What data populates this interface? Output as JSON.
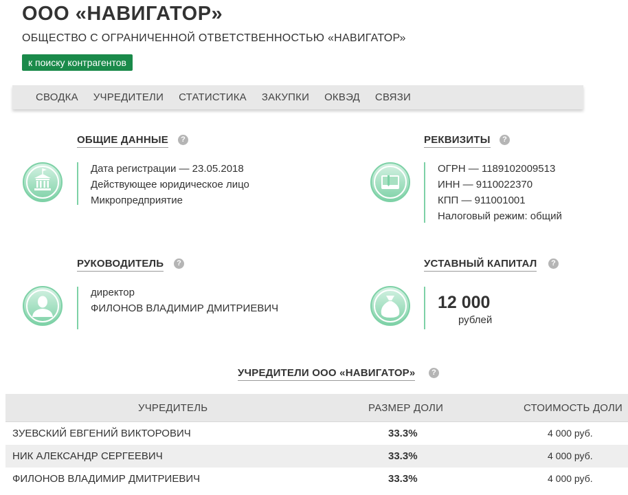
{
  "header": {
    "title": "ООО «НАВИГАТОР»",
    "full_name": "ОБЩЕСТВО С ОГРАНИЧЕННОЙ ОТВЕТСТВЕННОСТЬЮ «НАВИГАТОР»",
    "back_button": "к поиску контрагентов"
  },
  "nav": [
    "СВОДКА",
    "УЧРЕДИТЕЛИ",
    "СТАТИСТИКА",
    "ЗАКУПКИ",
    "ОКВЭД",
    "СВЯЗИ"
  ],
  "general": {
    "heading": "ОБЩИЕ ДАННЫЕ",
    "lines": [
      "Дата регистрации — 23.05.2018",
      "Действующее юридическое лицо",
      "Микропредприятие"
    ]
  },
  "requisites": {
    "heading": "РЕКВИЗИТЫ",
    "lines": [
      "ОГРН — 1189102009513",
      "ИНН — 9110022370",
      "КПП — 911001001",
      "Налоговый режим: общий"
    ]
  },
  "director": {
    "heading": "РУКОВОДИТЕЛЬ",
    "position": "директор",
    "name": "ФИЛОНОВ ВЛАДИМИР ДМИТРИЕВИЧ"
  },
  "capital": {
    "heading": "УСТАВНЫЙ КАПИТАЛ",
    "amount": "12 000",
    "unit": "рублей"
  },
  "help_glyph": "?",
  "founders": {
    "heading": "УЧРЕДИТЕЛИ ООО «НАВИГАТОР»",
    "columns": [
      "УЧРЕДИТЕЛЬ",
      "РАЗМЕР ДОЛИ",
      "СТОИМОСТЬ ДОЛИ"
    ],
    "rows": [
      {
        "name": "ЗУЕВСКИЙ ЕВГЕНИЙ ВИКТОРОВИЧ",
        "share": "33.3%",
        "cost": "4 000 руб."
      },
      {
        "name": "НИК АЛЕКСАНДР СЕРГЕЕВИЧ",
        "share": "33.3%",
        "cost": "4 000 руб."
      },
      {
        "name": "ФИЛОНОВ ВЛАДИМИР ДМИТРИЕВИЧ",
        "share": "33.3%",
        "cost": "4 000 руб."
      }
    ]
  },
  "colors": {
    "accent": "#1a8a4a",
    "icon_green": "#7dd1a6",
    "nav_bg": "#e8e8e8"
  },
  "icons": [
    "building-icon",
    "book-icon",
    "person-icon",
    "money-bag-icon",
    "help-icon"
  ]
}
